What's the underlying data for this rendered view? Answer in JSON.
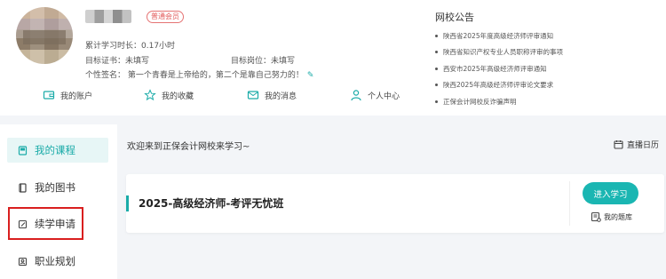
{
  "profile": {
    "badge": "普通会员",
    "study_time": "累计学习时长：0.17小时",
    "target_cert": "目标证书：未填写",
    "target_post": "目标岗位：未填写",
    "signature": "个性签名：  第一个青春是上帝给的，第二个是靠自己努力的！"
  },
  "quick_links": [
    {
      "label": "我的账户",
      "icon": "wallet-icon"
    },
    {
      "label": "我的收藏",
      "icon": "star-icon"
    },
    {
      "label": "我的消息",
      "icon": "mail-icon"
    },
    {
      "label": "个人中心",
      "icon": "user-icon"
    }
  ],
  "notices": {
    "title": "网校公告",
    "items": [
      "陕西省2025年度高级经济师评审通知",
      "陕西省知识产权专业人员职称评审的事项",
      "西安市2025年高级经济师评审通知",
      "陕西2025年高级经济师评审论文要求",
      "正保会计网校反诈骗声明"
    ]
  },
  "sidebar": {
    "items": [
      {
        "label": "我的课程",
        "icon": "course-icon",
        "active": true
      },
      {
        "label": "我的图书",
        "icon": "book-icon",
        "active": false
      },
      {
        "label": "续学申请",
        "icon": "edit-icon",
        "active": false
      },
      {
        "label": "职业规划",
        "icon": "career-icon",
        "active": false
      }
    ]
  },
  "main": {
    "welcome": "欢迎来到正保会计网校来学习~",
    "calendar_label": "直播日历",
    "course": {
      "title": "2025-高级经济师-考评无忧班",
      "enter_button": "进入学习",
      "bank_link": "我的题库"
    }
  },
  "colors": {
    "accent": "#1ab6b2",
    "highlight": "#d91f1f",
    "badge": "#e25c5c"
  }
}
